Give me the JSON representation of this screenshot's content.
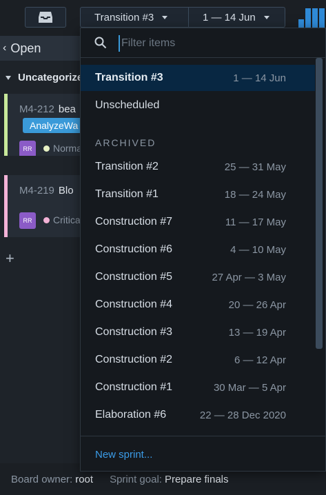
{
  "toolbar": {
    "sprint_label": "Transition #3",
    "date_label": "1 — 14 Jun"
  },
  "board": {
    "column_title": "Open",
    "group_title": "Uncategorized",
    "cards": [
      {
        "key": "M4-212",
        "title": "bea",
        "tag": "AnalyzeWa",
        "avatar": "RR",
        "priority": "Norma",
        "priority_color": "#e6f0c3",
        "accent": "#c7e89a"
      },
      {
        "key": "M4-219",
        "title": "Blo",
        "avatar": "RR",
        "priority": "Critica",
        "priority_color": "#f3b2d6",
        "accent": "#f3b2d6"
      }
    ]
  },
  "footer": {
    "owner_label": "Board owner:",
    "owner_value": "root",
    "goal_label": "Sprint goal:",
    "goal_value": "Prepare finals"
  },
  "dropdown": {
    "search_placeholder": "Filter items",
    "items": [
      {
        "name": "Transition #3",
        "dates": "1 — 14 Jun",
        "active": true
      },
      {
        "name": "Unscheduled",
        "dates": ""
      }
    ],
    "archived_title": "ARCHIVED",
    "archived": [
      {
        "name": "Transition #2",
        "dates": "25 — 31 May"
      },
      {
        "name": "Transition #1",
        "dates": "18 — 24 May"
      },
      {
        "name": "Construction #7",
        "dates": "11 — 17 May"
      },
      {
        "name": "Construction #6",
        "dates": "4 — 10 May"
      },
      {
        "name": "Construction #5",
        "dates": "27 Apr — 3 May"
      },
      {
        "name": "Construction #4",
        "dates": "20 — 26 Apr"
      },
      {
        "name": "Construction #3",
        "dates": "13 — 19 Apr"
      },
      {
        "name": "Construction #2",
        "dates": "6 — 12 Apr"
      },
      {
        "name": "Construction #1",
        "dates": "30 Mar — 5 Apr"
      },
      {
        "name": "Elaboration #6",
        "dates": "22 — 28 Dec 2020"
      }
    ],
    "new_sprint_label": "New sprint..."
  }
}
